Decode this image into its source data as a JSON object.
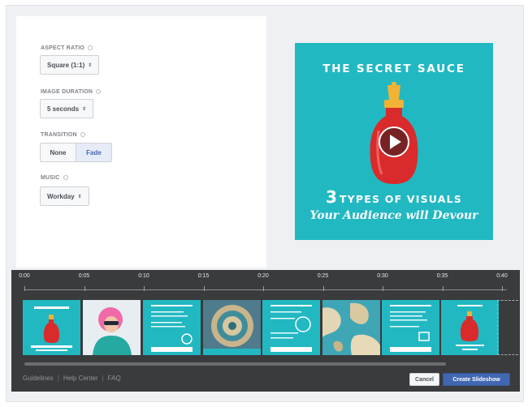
{
  "settings": {
    "aspect_ratio": {
      "label": "ASPECT RATIO",
      "value": "Square (1:1)"
    },
    "image_duration": {
      "label": "IMAGE DURATION",
      "value": "5 seconds"
    },
    "transition": {
      "label": "TRANSITION",
      "options": [
        "None",
        "Fade"
      ],
      "selected": "Fade"
    },
    "music": {
      "label": "MUSIC",
      "value": "Workday"
    }
  },
  "preview": {
    "title": "THE SECRET SAUCE",
    "line1_number": "3",
    "line1_text": "TYPES OF VISUALS",
    "line2": "Your Audience will Devour",
    "background_color": "#22b8c2"
  },
  "timeline": {
    "ticks": [
      "0:00",
      "0:05",
      "0:10",
      "0:15",
      "0:20",
      "0:25",
      "0:30",
      "0:35",
      "0:40"
    ],
    "thumbnails": [
      {
        "name": "secret-sauce-title-slide"
      },
      {
        "name": "pink-hair-photo-slide"
      },
      {
        "name": "text-slide-1"
      },
      {
        "name": "ornate-plate-photo-slide"
      },
      {
        "name": "text-slide-2"
      },
      {
        "name": "aerial-rocks-photo-slide"
      },
      {
        "name": "text-slide-3"
      },
      {
        "name": "closing-sauce-slide"
      }
    ]
  },
  "footer": {
    "links": [
      "Guidelines",
      "Help Center",
      "FAQ"
    ],
    "cancel_label": "Cancel",
    "create_label": "Create Slideshow"
  },
  "colors": {
    "accent": "#4267b2",
    "timeline_bg": "#3a3b3c",
    "teal": "#22b8c2"
  }
}
